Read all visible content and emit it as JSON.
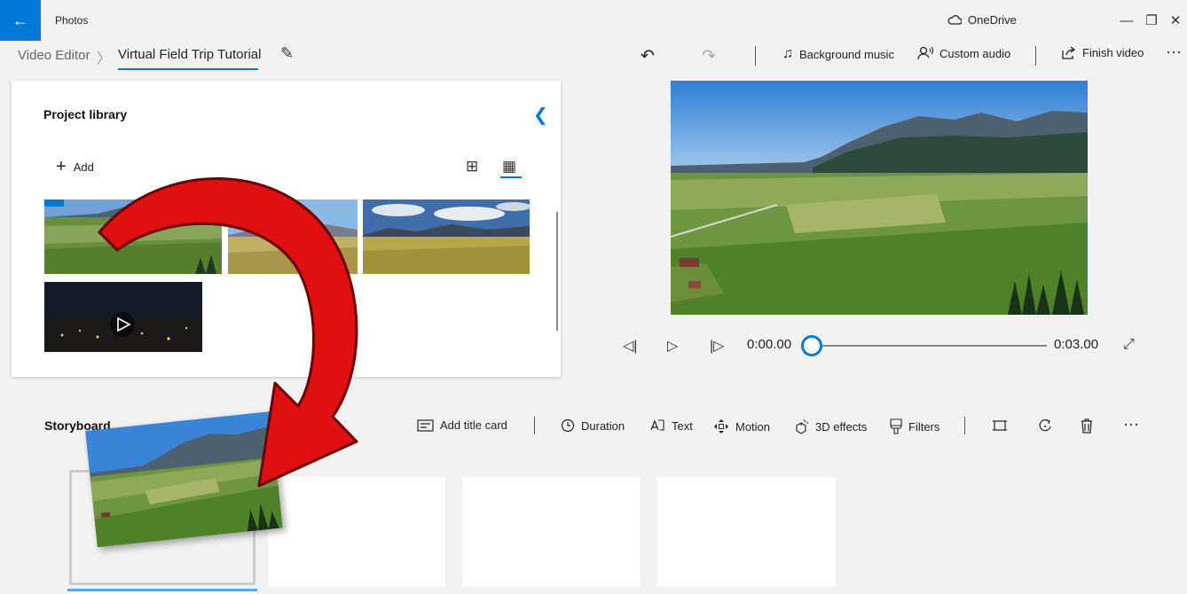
{
  "app": {
    "title": "Photos",
    "onedrive_label": "OneDrive"
  },
  "window_controls": {
    "minimize": "—",
    "restore": "❐",
    "close": "✕"
  },
  "breadcrumb": {
    "root": "Video Editor",
    "separator": "〉",
    "project": "Virtual Field Trip Tutorial"
  },
  "toolbar": {
    "undo_icon": "↶",
    "redo_icon": "↷",
    "background_music": "Background music",
    "custom_audio": "Custom audio",
    "finish_video": "Finish video",
    "more": "···"
  },
  "library": {
    "title": "Project library",
    "add_label": "Add",
    "view_modes": [
      "grid-large",
      "grid-small"
    ],
    "items": [
      {
        "kind": "landscape-aerial"
      },
      {
        "kind": "grass-mountains"
      },
      {
        "kind": "grass-clouds"
      },
      {
        "kind": "night-video"
      }
    ]
  },
  "preview": {
    "time_current": "0:00.00",
    "time_total": "0:03.00",
    "position": 0.0
  },
  "storyboard": {
    "title": "Storyboard",
    "commands": {
      "add_title_card": "Add title card",
      "duration": "Duration",
      "text": "Text",
      "motion": "Motion",
      "effects_3d": "3D effects",
      "filters": "Filters",
      "more": "···"
    },
    "slot_count": 4
  },
  "colors": {
    "accent": "#0078d7",
    "arrow_red": "#e01010",
    "window_bg": "#f2f2f2"
  }
}
